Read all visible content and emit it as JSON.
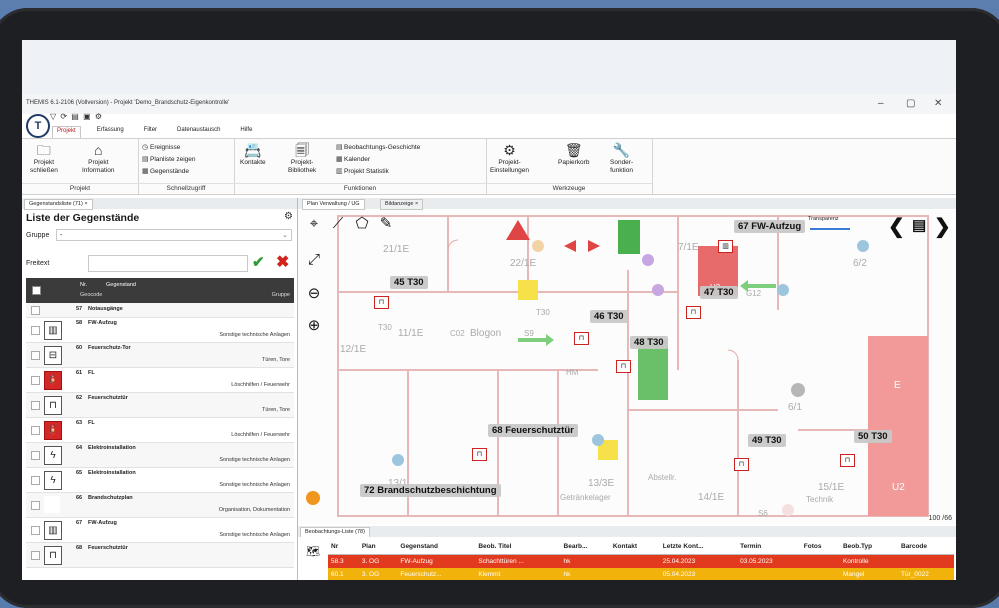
{
  "window": {
    "title": "THEMIS 6.1-2106 (Vollversion) - Projekt 'Demo_Brandschutz-Eigenkontrolle'",
    "controls": [
      "–",
      "▢",
      "✕"
    ]
  },
  "menu_tabs": [
    "Projekt",
    "Erfassung",
    "Filter",
    "Datenaustausch",
    "Hilfe"
  ],
  "ribbon": {
    "projekt": {
      "group": "Projekt",
      "btn1": [
        "Projekt",
        "schließen"
      ],
      "btn2": [
        "Projekt",
        "Information"
      ]
    },
    "schnellzugriff": {
      "group": "Schnellzugriff",
      "items": [
        "Ereignisse",
        "Planliste zeigen",
        "Gegenstände"
      ]
    },
    "funktionen": {
      "group": "Funktionen",
      "kontakte": "Kontakte",
      "bibliothek": [
        "Projekt-",
        "Bibliothek"
      ],
      "items": [
        "Beobachtungs-Geschichte",
        "Kalender",
        "Projekt Statistik"
      ]
    },
    "werkzeuge": {
      "group": "Werkzeuge",
      "einstellungen": [
        "Projekt-",
        "Einstellungen"
      ],
      "papierkorb": "Papierkorb",
      "sonder": [
        "Sonder-",
        "funktion"
      ]
    }
  },
  "left_panel": {
    "tab": "Gegenstandsliste (71) ×",
    "title": "Liste der Gegenstände",
    "gruppe_label": "Gruppe",
    "gruppe_value": "-",
    "freitext_label": "Freitext",
    "freitext_value": "",
    "header": {
      "nr": "Nr.",
      "gegenstand": "Gegenstand",
      "geocode": "Geocode",
      "gruppe": "Gruppe"
    },
    "rows": [
      {
        "nr": "57",
        "name": "Notausgänge",
        "group": "",
        "icon": "",
        "red": false,
        "short": true
      },
      {
        "nr": "58",
        "name": "FW-Aufzug",
        "group": "Sonstige technische Anlagen",
        "icon": "elevator-icon",
        "red": false
      },
      {
        "nr": "60",
        "name": "Feuerschutz-Tor",
        "group": "Türen, Tore",
        "icon": "gate-icon",
        "red": false
      },
      {
        "nr": "61",
        "name": "FL",
        "group": "Löschhilfen / Feuerwehr",
        "icon": "extinguisher-icon",
        "red": true
      },
      {
        "nr": "62",
        "name": "Feuerschutztür",
        "group": "Türen, Tore",
        "icon": "door-icon",
        "red": false
      },
      {
        "nr": "63",
        "name": "FL",
        "group": "Löschhilfen / Feuerwehr",
        "icon": "extinguisher-icon",
        "red": true
      },
      {
        "nr": "64",
        "name": "Elektroinstallation",
        "group": "Sonstige technische Anlagen",
        "icon": "lightning-icon",
        "red": false
      },
      {
        "nr": "65",
        "name": "Elektroinstallation",
        "group": "Sonstige technische Anlagen",
        "icon": "lightning-icon",
        "red": false
      },
      {
        "nr": "66",
        "name": "Brandschutzplan",
        "group": "Organisation, Dokumentation",
        "icon": "",
        "red": false
      },
      {
        "nr": "67",
        "name": "FW-Aufzug",
        "group": "Sonstige technische Anlagen",
        "icon": "elevator-icon",
        "red": false
      },
      {
        "nr": "68",
        "name": "Feuerschutztür",
        "group": "",
        "icon": "door-icon",
        "red": false
      }
    ]
  },
  "plan": {
    "tabs": [
      "Plan Verwaltung / UG",
      "Bildanzeige ×"
    ],
    "transparent_label": "Transparenz",
    "zoom": "100 /66",
    "markers": [
      {
        "label": "67 FW-Aufzug"
      },
      {
        "label": "45 T30"
      },
      {
        "label": "47 T30"
      },
      {
        "label": "46 T30"
      },
      {
        "label": "48 T30"
      },
      {
        "label": "68 Feuerschutztür"
      },
      {
        "label": "49 T30"
      },
      {
        "label": "50 T30"
      },
      {
        "label": "72 Brandschutzbeschichtung"
      }
    ],
    "room_labels": [
      "21/1E",
      "22/1E",
      "7/1E",
      "6/2",
      "11/1E",
      "12/1E",
      "Blogon",
      "6/1",
      "13/1",
      "13/3E",
      "Abstellr.",
      "14/1E",
      "15/1E",
      "Technik",
      "Getränkelager",
      "U2",
      "U2",
      "E",
      "T30",
      "T30",
      "HM",
      "G12",
      "C02",
      "S9",
      "S6"
    ]
  },
  "obs_list": {
    "tab": "Beobachtungs-Liste (78)",
    "columns": [
      "Nr",
      "Plan",
      "Gegenstand",
      "Beob. Titel",
      "Bearb...",
      "Kontakt",
      "Letzte Kont...",
      "Termin",
      "Fotos",
      "Beob.Typ",
      "Barcode"
    ],
    "rows": [
      [
        "58.3",
        "3. OG",
        "FW-Aufzug",
        "Schachttüren ...",
        "hk",
        "",
        "25.04.2023",
        "03.05.2023",
        "",
        "Kontrolle",
        ""
      ],
      [
        "60.1",
        "3. OG",
        "Feuerschutz...",
        "Klemmt",
        "hk",
        "",
        "05.04.2023",
        "",
        "",
        "Mangel",
        "Tür_0022"
      ]
    ]
  }
}
